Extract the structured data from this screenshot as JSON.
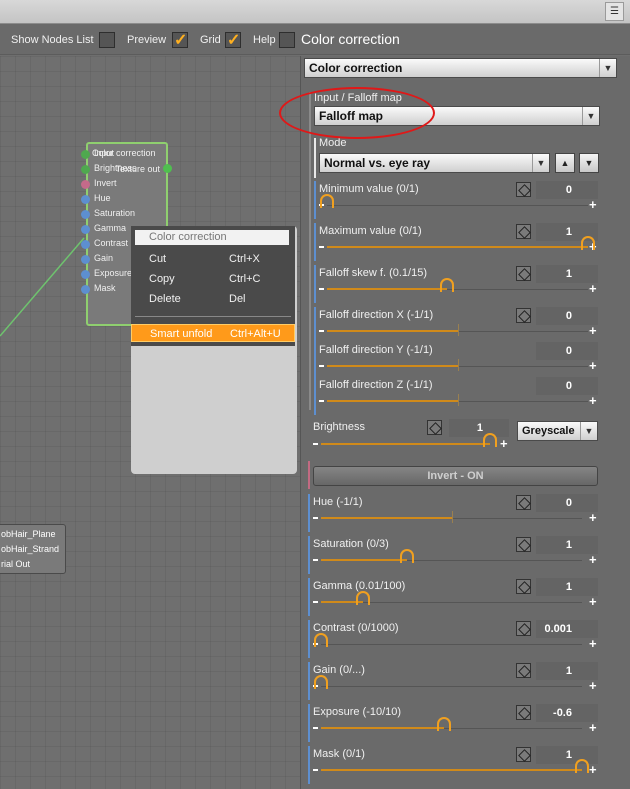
{
  "toolbar": {
    "show_nodes_list": "Show Nodes List",
    "preview": "Preview",
    "grid": "Grid",
    "help": "Help",
    "panel_title": "Color correction"
  },
  "node": {
    "title": "Color correction",
    "output": "Texture out",
    "ports": [
      "Input",
      "Brightness",
      "Invert",
      "Hue",
      "Saturation",
      "Gamma",
      "Contrast",
      "Gain",
      "Exposure",
      "Mask"
    ]
  },
  "node2": {
    "lines": [
      "obHair_Plane",
      "obHair_Strand",
      "rial Out"
    ]
  },
  "context_menu": {
    "title": "Color correction",
    "items": [
      {
        "label": "Cut",
        "shortcut": "Ctrl+X"
      },
      {
        "label": "Copy",
        "shortcut": "Ctrl+C"
      },
      {
        "label": "Delete",
        "shortcut": "Del"
      }
    ],
    "highlight": {
      "label": "Smart unfold",
      "shortcut": "Ctrl+Alt+U"
    }
  },
  "panel": {
    "texture_select": "Color correction",
    "input_label": "Input / Falloff map",
    "input_select": "Falloff map",
    "mode_label": "Mode",
    "mode_select": "Normal vs. eye ray",
    "falloff_params": [
      {
        "label": "Minimum value (0/1)",
        "value": "0",
        "level": 0
      },
      {
        "label": "Maximum value (0/1)",
        "value": "1",
        "level": 1
      },
      {
        "label": "Falloff skew f. (0.1/15)",
        "value": "1",
        "level": 0.46
      },
      {
        "label": "Falloff direction X (-1/1)",
        "value": "0",
        "level": 0.5
      },
      {
        "label": "Falloff direction Y (-1/1)",
        "value": "0",
        "level": 0.5
      },
      {
        "label": "Falloff direction Z (-1/1)",
        "value": "0",
        "level": 0.5
      }
    ],
    "brightness": {
      "label": "Brightness",
      "value": "1",
      "level": 1,
      "mode": "Greyscale"
    },
    "invert_button": "Invert - ON",
    "params": [
      {
        "label": "Hue (-1/1)",
        "value": "0",
        "level": 0.5
      },
      {
        "label": "Saturation (0/3)",
        "value": "1",
        "level": 0.33
      },
      {
        "label": "Gamma (0.01/100)",
        "value": "1",
        "level": 0.16
      },
      {
        "label": "Contrast (0/1000)",
        "value": "0.001",
        "level": 0
      },
      {
        "label": "Gain (0/...)",
        "value": "1",
        "level": 0
      },
      {
        "label": "Exposure (-10/10)",
        "value": "-0.6",
        "level": 0.47
      },
      {
        "label": "Mask (0/1)",
        "value": "1",
        "level": 1
      }
    ]
  },
  "colors": {
    "accent": "#f0a020",
    "node_border": "#8fcf6f",
    "highlight": "#ff9a1a",
    "annotation": "#e01818"
  }
}
